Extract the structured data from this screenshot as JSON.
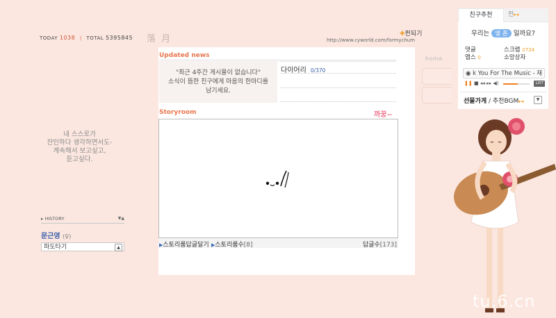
{
  "header": {
    "today_label": "TODAY",
    "today_count": "1038",
    "total_label": "TOTAL",
    "total_count": "5395845",
    "title": "落 月",
    "url": "http://www.cyworld.com/formychum",
    "follow_label": "펀되기"
  },
  "left": {
    "intro_lines": [
      "내 스스로가",
      "잔인하다 생각하면서도-",
      "계속해서 보고싶고,",
      "듣고싶다."
    ],
    "history_label": "HISTORY",
    "owner_name": "문근영",
    "owner_sex": "(♀)",
    "dropdown_value": "파도타기"
  },
  "updated_news": {
    "title": "Updated news",
    "empty_lines": [
      "\"최근 4주간 게시물이 없습니다\"",
      "소식이 뜸한 친구에게 마음의 한마디를",
      "남기세요."
    ],
    "diary_label": "다이어리",
    "diary_count": "0/370"
  },
  "storyroom": {
    "title": "Storyroom",
    "side_text": "까꿍~",
    "footer_link_1": "스토리룸답글달기",
    "footer_link_2": "스토리룸수",
    "footer_link_2_count": "[8]",
    "reply_label": "답글수",
    "reply_count": "[173]"
  },
  "menu": {
    "home_label": "home"
  },
  "widget": {
    "tab_friend": "친구추천",
    "tab_pan": "펀",
    "ask_prefix": "우리는",
    "ask_pill": "몇 촌",
    "ask_suffix": "일까요?",
    "stats": [
      {
        "label": "댓글",
        "count": "",
        "label2": "스크랩",
        "count2": "2724"
      },
      {
        "label": "앱스",
        "count": "0",
        "label2": "소망상자",
        "count2": ""
      }
    ],
    "music_title": "k You For The Music - 재",
    "list_label": "LIST",
    "volume_level": 0.55,
    "gift_label": "선물가게",
    "bgm_label": "추천BGM"
  },
  "watermark": "tu.6.cn",
  "colors": {
    "background": "#fbe7e0",
    "accent_orange": "#e8764f",
    "link_blue": "#3a5ea8",
    "pink": "#ee7089"
  }
}
